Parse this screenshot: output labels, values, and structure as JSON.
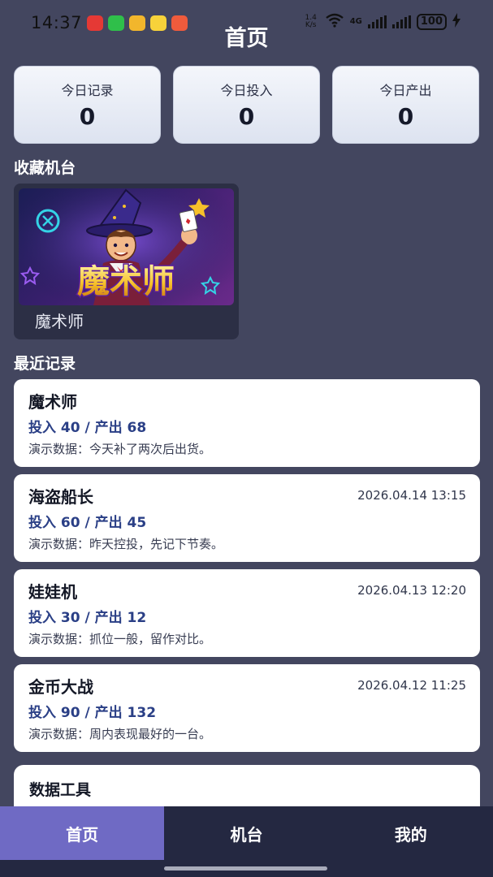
{
  "status_bar": {
    "time": "14:37",
    "net_speed_value": "1.4",
    "net_speed_unit": "K/s",
    "network_type": "4G",
    "wifi_label": "6",
    "battery": "100",
    "app_icons": [
      "huawei-store-icon",
      "wechat-icon",
      "email-icon",
      "photos-icon",
      "gallery-icon"
    ],
    "icons": [
      "wifi-icon",
      "signal-icon",
      "battery-icon",
      "charging-icon"
    ]
  },
  "header": {
    "title": "首页"
  },
  "stats": [
    {
      "label": "今日记录",
      "value": "0"
    },
    {
      "label": "今日投入",
      "value": "0"
    },
    {
      "label": "今日产出",
      "value": "0"
    }
  ],
  "favorites": {
    "title": "收藏机台",
    "items": [
      {
        "name": "魔术师",
        "art_title": "魔术师"
      }
    ]
  },
  "recent": {
    "title": "最近记录",
    "items": [
      {
        "name": "魔术师",
        "date": "",
        "amount": "投入 40 / 产出 68",
        "note": "演示数据：今天补了两次后出货。"
      },
      {
        "name": "海盗船长",
        "date": "2026.04.14 13:15",
        "amount": "投入 60 / 产出 45",
        "note": "演示数据：昨天控投，先记下节奏。"
      },
      {
        "name": "娃娃机",
        "date": "2026.04.13 12:20",
        "amount": "投入 30 / 产出 12",
        "note": "演示数据：抓位一般，留作对比。"
      },
      {
        "name": "金币大战",
        "date": "2026.04.12 11:25",
        "amount": "投入 90 / 产出 132",
        "note": "演示数据：周内表现最好的一台。"
      }
    ]
  },
  "tools": {
    "title": "数据工具"
  },
  "tab_bar": {
    "tabs": [
      {
        "label": "首页",
        "active": true
      },
      {
        "label": "机台",
        "active": false
      },
      {
        "label": "我的",
        "active": false
      }
    ]
  },
  "colors": {
    "background": "#43465f",
    "tab_bar": "#242841",
    "tab_active": "#6f6ac4",
    "amount_text": "#2a3f86"
  }
}
